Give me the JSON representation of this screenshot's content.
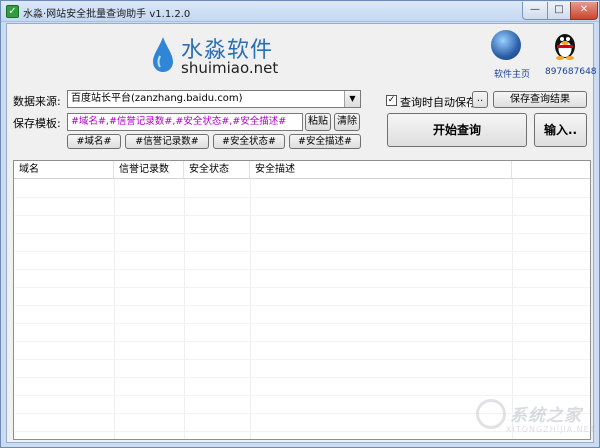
{
  "window": {
    "title": "水淼·网站安全批量查询助手 v1.1.2.0",
    "app_icon": "check-icon"
  },
  "window_buttons": {
    "minimize": "—",
    "maximize": "□",
    "close": "✕"
  },
  "branding": {
    "logo_cn": "水淼软件",
    "logo_en": "shuimiao.net",
    "home_label": "软件主页",
    "qq_label": "897687648"
  },
  "source": {
    "label": "数据来源:",
    "selected": "百度站长平台(zanzhang.baidu.com)"
  },
  "autosave": {
    "checked": true,
    "label": "查询时自动保存",
    "browse_label": "..",
    "save_results_label": "保存查询结果"
  },
  "template": {
    "label": "保存模板:",
    "value": "#域名#,#信誉记录数#,#安全状态#,#安全描述#",
    "paste_label": "粘贴",
    "clear_label": "清除",
    "tokens": [
      "#域名#",
      "#信誉记录数#",
      "#安全状态#",
      "#安全描述#"
    ]
  },
  "actions": {
    "start_label": "开始查询",
    "input_label": "输入.."
  },
  "table": {
    "columns": [
      "域名",
      "信誉记录数",
      "安全状态",
      "安全描述"
    ],
    "rows": []
  },
  "watermark": {
    "text": "系统之家",
    "sub": "XITONGZHIJIA.NET"
  },
  "colors": {
    "title_bg": "#c4d8f1",
    "logo_blue": "#2a6fb5",
    "template_text": "#b000c8",
    "link": "#1a3f9a"
  }
}
